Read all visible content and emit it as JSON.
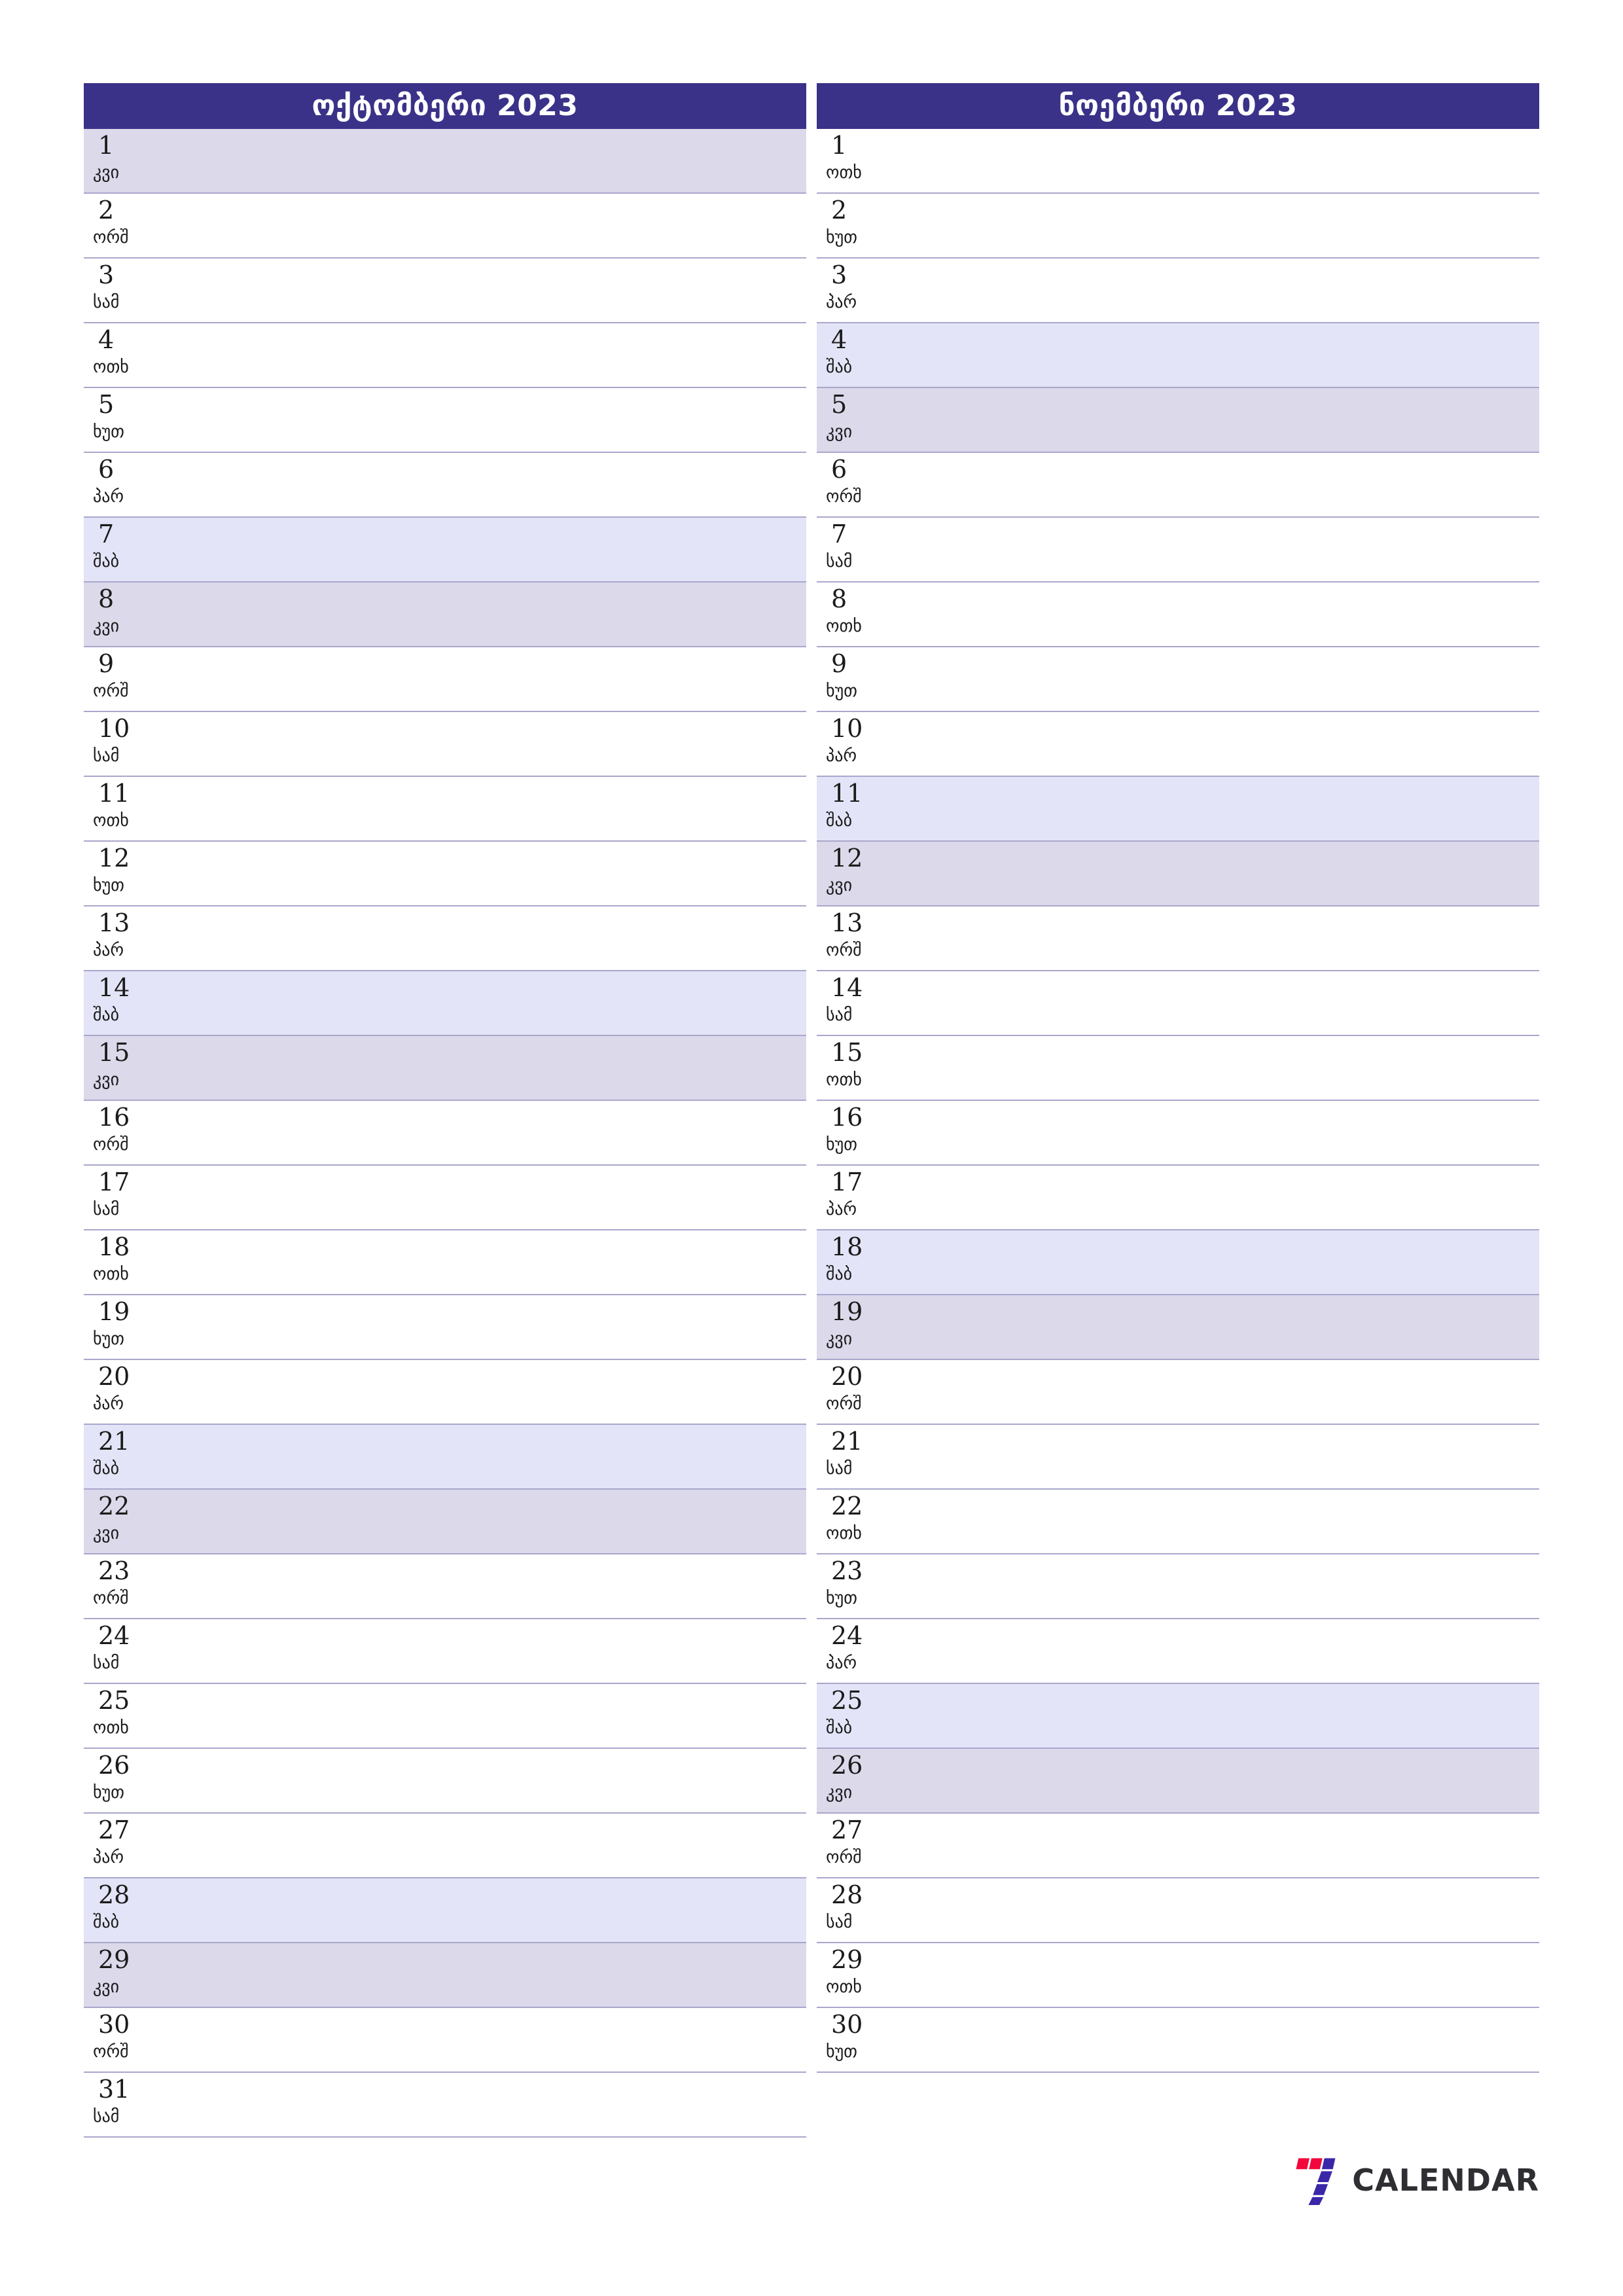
{
  "document": {
    "type": "monthly-planner",
    "year": "2023",
    "page_background": "#ffffff"
  },
  "colors": {
    "header_background": "#3a3288",
    "header_text": "#ffffff",
    "saturday_row": "#e3e4f7",
    "sunday_row": "#dbd9ea",
    "row_divider": "#a9a7cc",
    "day_text": "#1b1b1b",
    "brand_red": "#f2063c",
    "brand_blue": "#3a27a8",
    "brand_word": "#2e2e33"
  },
  "months": [
    {
      "title": "ოქტომბერი 2023",
      "name": "ოქტომბერი",
      "days": [
        {
          "num": "1",
          "abbr": "კვი",
          "type": "sun"
        },
        {
          "num": "2",
          "abbr": "ორშ",
          "type": "weekday"
        },
        {
          "num": "3",
          "abbr": "სამ",
          "type": "weekday"
        },
        {
          "num": "4",
          "abbr": "ოთხ",
          "type": "weekday"
        },
        {
          "num": "5",
          "abbr": "ხუთ",
          "type": "weekday"
        },
        {
          "num": "6",
          "abbr": "პარ",
          "type": "weekday"
        },
        {
          "num": "7",
          "abbr": "შაბ",
          "type": "sat"
        },
        {
          "num": "8",
          "abbr": "კვი",
          "type": "sun"
        },
        {
          "num": "9",
          "abbr": "ორშ",
          "type": "weekday"
        },
        {
          "num": "10",
          "abbr": "სამ",
          "type": "weekday"
        },
        {
          "num": "11",
          "abbr": "ოთხ",
          "type": "weekday"
        },
        {
          "num": "12",
          "abbr": "ხუთ",
          "type": "weekday"
        },
        {
          "num": "13",
          "abbr": "პარ",
          "type": "weekday"
        },
        {
          "num": "14",
          "abbr": "შაბ",
          "type": "sat"
        },
        {
          "num": "15",
          "abbr": "კვი",
          "type": "sun"
        },
        {
          "num": "16",
          "abbr": "ორშ",
          "type": "weekday"
        },
        {
          "num": "17",
          "abbr": "სამ",
          "type": "weekday"
        },
        {
          "num": "18",
          "abbr": "ოთხ",
          "type": "weekday"
        },
        {
          "num": "19",
          "abbr": "ხუთ",
          "type": "weekday"
        },
        {
          "num": "20",
          "abbr": "პარ",
          "type": "weekday"
        },
        {
          "num": "21",
          "abbr": "შაბ",
          "type": "sat"
        },
        {
          "num": "22",
          "abbr": "კვი",
          "type": "sun"
        },
        {
          "num": "23",
          "abbr": "ორშ",
          "type": "weekday"
        },
        {
          "num": "24",
          "abbr": "სამ",
          "type": "weekday"
        },
        {
          "num": "25",
          "abbr": "ოთხ",
          "type": "weekday"
        },
        {
          "num": "26",
          "abbr": "ხუთ",
          "type": "weekday"
        },
        {
          "num": "27",
          "abbr": "პარ",
          "type": "weekday"
        },
        {
          "num": "28",
          "abbr": "შაბ",
          "type": "sat"
        },
        {
          "num": "29",
          "abbr": "კვი",
          "type": "sun"
        },
        {
          "num": "30",
          "abbr": "ორშ",
          "type": "weekday"
        },
        {
          "num": "31",
          "abbr": "სამ",
          "type": "weekday"
        }
      ]
    },
    {
      "title": "ნოემბერი 2023",
      "name": "ნოემბერი",
      "days": [
        {
          "num": "1",
          "abbr": "ოთხ",
          "type": "weekday"
        },
        {
          "num": "2",
          "abbr": "ხუთ",
          "type": "weekday"
        },
        {
          "num": "3",
          "abbr": "პარ",
          "type": "weekday"
        },
        {
          "num": "4",
          "abbr": "შაბ",
          "type": "sat"
        },
        {
          "num": "5",
          "abbr": "კვი",
          "type": "sun"
        },
        {
          "num": "6",
          "abbr": "ორშ",
          "type": "weekday"
        },
        {
          "num": "7",
          "abbr": "სამ",
          "type": "weekday"
        },
        {
          "num": "8",
          "abbr": "ოთხ",
          "type": "weekday"
        },
        {
          "num": "9",
          "abbr": "ხუთ",
          "type": "weekday"
        },
        {
          "num": "10",
          "abbr": "პარ",
          "type": "weekday"
        },
        {
          "num": "11",
          "abbr": "შაბ",
          "type": "sat"
        },
        {
          "num": "12",
          "abbr": "კვი",
          "type": "sun"
        },
        {
          "num": "13",
          "abbr": "ორშ",
          "type": "weekday"
        },
        {
          "num": "14",
          "abbr": "სამ",
          "type": "weekday"
        },
        {
          "num": "15",
          "abbr": "ოთხ",
          "type": "weekday"
        },
        {
          "num": "16",
          "abbr": "ხუთ",
          "type": "weekday"
        },
        {
          "num": "17",
          "abbr": "პარ",
          "type": "weekday"
        },
        {
          "num": "18",
          "abbr": "შაბ",
          "type": "sat"
        },
        {
          "num": "19",
          "abbr": "კვი",
          "type": "sun"
        },
        {
          "num": "20",
          "abbr": "ორშ",
          "type": "weekday"
        },
        {
          "num": "21",
          "abbr": "სამ",
          "type": "weekday"
        },
        {
          "num": "22",
          "abbr": "ოთხ",
          "type": "weekday"
        },
        {
          "num": "23",
          "abbr": "ხუთ",
          "type": "weekday"
        },
        {
          "num": "24",
          "abbr": "პარ",
          "type": "weekday"
        },
        {
          "num": "25",
          "abbr": "შაბ",
          "type": "sat"
        },
        {
          "num": "26",
          "abbr": "კვი",
          "type": "sun"
        },
        {
          "num": "27",
          "abbr": "ორშ",
          "type": "weekday"
        },
        {
          "num": "28",
          "abbr": "სამ",
          "type": "weekday"
        },
        {
          "num": "29",
          "abbr": "ოთხ",
          "type": "weekday"
        },
        {
          "num": "30",
          "abbr": "ხუთ",
          "type": "weekday"
        }
      ]
    }
  ],
  "brand": {
    "word": "CALENDAR",
    "mark": "seven-logo-icon"
  }
}
